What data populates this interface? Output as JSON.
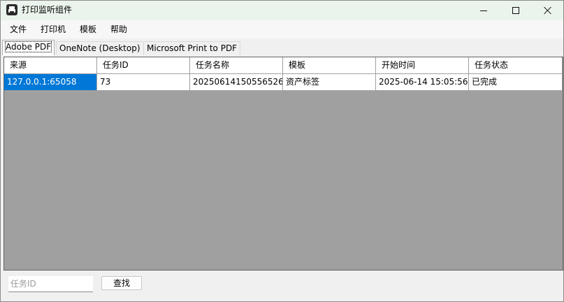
{
  "window": {
    "title": "打印监听组件"
  },
  "menu": {
    "items": [
      "文件",
      "打印机",
      "模板",
      "帮助"
    ]
  },
  "tabs": [
    "Adobe PDF",
    "OneNote (Desktop)",
    "Microsoft Print to PDF"
  ],
  "active_tab": "Adobe PDF",
  "table": {
    "columns": [
      "来源",
      "任务ID",
      "任务名称",
      "模板",
      "开始时间",
      "任务状态"
    ],
    "rows": [
      [
        "127.0.0.1:65058",
        "73",
        "20250614150556526",
        "资产标签",
        "2025-06-14 15:05:56",
        "已完成"
      ]
    ],
    "selected_cell": "127.0.0.1:65058"
  },
  "search": {
    "placeholder": "任务ID",
    "value": ""
  },
  "find_button_label": "查找",
  "colors": {
    "selection": "#0078d7",
    "grid_background": "#a0a0a0",
    "titlebar": "#eaf4ec"
  },
  "icons": [
    "printer-icon",
    "minimize-icon",
    "maximize-icon",
    "close-icon"
  ]
}
